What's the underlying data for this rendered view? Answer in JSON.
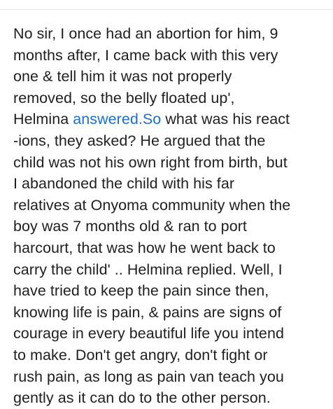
{
  "post": {
    "lines": [
      "No sir, I once had an abortion for him, 9",
      "months after, I came back with this very",
      "one & tell him it was not properly",
      "removed, so the belly floated up',",
      {
        "before": "Helmina ",
        "link": "answered.So",
        "after": " what was his react"
      },
      "-ions, they asked? He argued that the",
      "child was not his own right from birth, but",
      "I abandoned the child with his far",
      "relatives at Onyoma community when the",
      "boy was 7 months old & ran to port",
      "harcourt, that was how he went back to",
      "carry the child' .. Helmina replied. Well, I",
      "have tried to keep the pain since then,",
      "knowing life is pain, & pains are signs of",
      "courage in every beautiful life you intend",
      "to make. Don't get angry, don't fight or",
      "rush pain, as long as pain van teach you",
      "gently as it can do to the other person."
    ]
  },
  "colors": {
    "text": "#1f1f1f",
    "link": "#1a6fd1",
    "background": "#ffffff"
  }
}
